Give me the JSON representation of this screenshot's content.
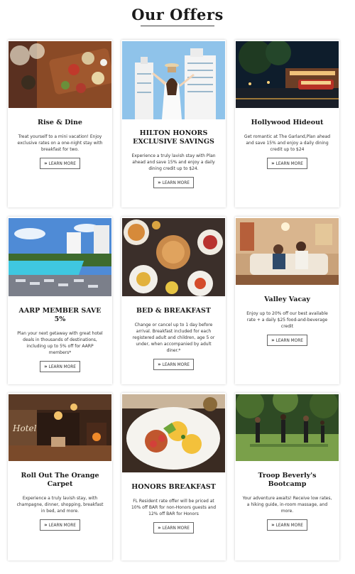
{
  "header": {
    "title": "Our Offers"
  },
  "cta_label": "LEARN MORE",
  "cta_icon": "double-chevron-right-icon",
  "offers": [
    {
      "title": "Rise & Dine",
      "text": "Treat yourself to a mini vacation! Enjoy exclusive rates on a one-night stay with breakfast for two."
    },
    {
      "title": "HILTON HONORS EXCLUSIVE SAVINGS",
      "text": "Experience a truly lavish stay with Plan ahead and save 15% and enjoy a daily dining credit up to $24."
    },
    {
      "title": "Hollywood Hideout",
      "text": "Get romantic at The Garland,Plan ahead and save 15% and enjoy a daily dining credit up to $24"
    },
    {
      "title": "AARP MEMBER SAVE 5%",
      "text": "Plan your next getaway with great hotel deals in thousands of destinations, including up to 5% off for AARP members*"
    },
    {
      "title": "BED & BREAKFAST",
      "text": "Change or cancel up to 1 day before arrival. Breakfast included for each registered adult and children, age 5 or under, when accompanied by adult diner.*"
    },
    {
      "title": "Valley Vacay",
      "text": "Enjoy up to 20% off our best available rate + a daily $25 food-and-beverage credit"
    },
    {
      "title": "Roll Out The Orange Carpet",
      "text": "Experience a truly lavish stay, with champagne, dinner, shopping, breakfast in bed, and more."
    },
    {
      "title": "HONORS BREAKFAST",
      "text": "FL Resident rate offer will be priced at 10% off BAR for non-Honors guests and 12% off BAR for Honors"
    },
    {
      "title": "Troop Beverly's Bootcamp",
      "text": "Your adventure awaits! Receive low rates, a hiking guide, in-room massage, and more."
    }
  ]
}
